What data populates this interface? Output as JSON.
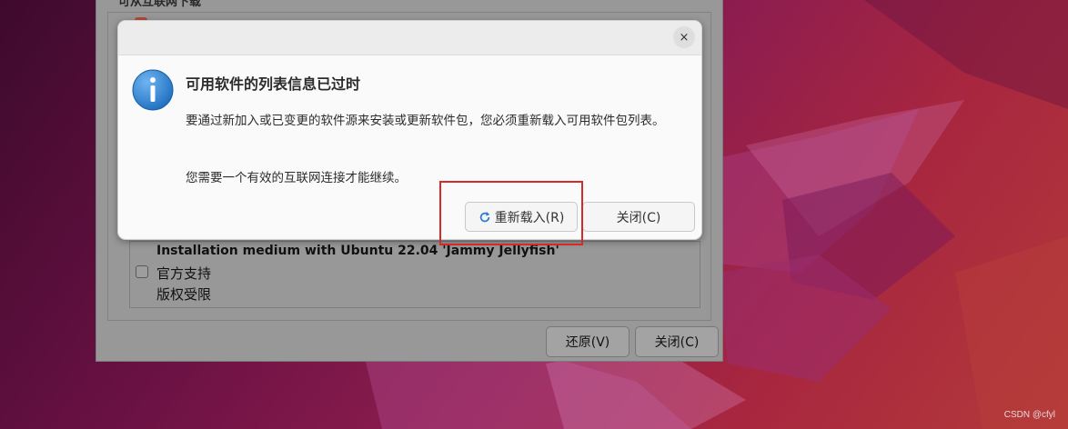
{
  "background_window": {
    "top_label": "可从互联网下载",
    "source_title": "Installation medium with Ubuntu 22.04 'Jammy Jellyfish'",
    "source_lines": [
      "官方支持",
      "版权受限"
    ],
    "revert_button": "还原(V)",
    "close_button": "关闭(C)"
  },
  "dialog": {
    "heading": "可用软件的列表信息已过时",
    "body": "要通过新加入或已变更的软件源来安装或更新软件包，您必须重新载入可用软件包列表。",
    "note": "您需要一个有效的互联网连接才能继续。",
    "reload_button": "重新载入(R)",
    "close_button": "关闭(C)",
    "close_icon": "×"
  },
  "watermark": "CSDN @cfyl",
  "colors": {
    "info_icon": "#2e86d6",
    "highlight": "#d42a2a"
  }
}
